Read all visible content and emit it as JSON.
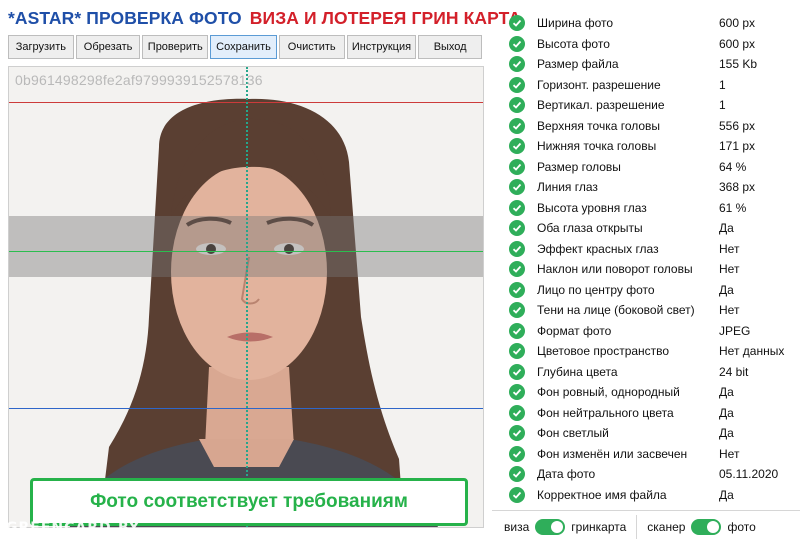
{
  "header": {
    "title_left": "*ASTAR* ПРОВЕРКА ФОТО",
    "title_right": "ВИЗА И ЛОТЕРЕЯ ГРИН КАРТА"
  },
  "toolbar": {
    "buttons": [
      "Загрузить",
      "Обрезать",
      "Проверить",
      "Сохранить",
      "Очистить",
      "Инструкция",
      "Выход"
    ],
    "active_index": 3
  },
  "photo": {
    "id_text": "0b961498298fe2af9799939152578136",
    "verdict": "Фото соответствует требованиям",
    "watermark": "GREENCARD.BY"
  },
  "checks": [
    {
      "label": "Ширина фото",
      "value": "600 px"
    },
    {
      "label": "Высота фото",
      "value": "600 px"
    },
    {
      "label": "Размер файла",
      "value": "155 Kb"
    },
    {
      "label": "Горизонт. разрешение",
      "value": "1"
    },
    {
      "label": "Вертикал. разрешение",
      "value": "1"
    },
    {
      "label": "Верхняя точка головы",
      "value": "556 px"
    },
    {
      "label": "Нижняя точка головы",
      "value": "171 px"
    },
    {
      "label": "Размер головы",
      "value": "64 %"
    },
    {
      "label": "Линия глаз",
      "value": "368 px"
    },
    {
      "label": "Высота уровня глаз",
      "value": "61 %"
    },
    {
      "label": "Оба глаза открыты",
      "value": "Да"
    },
    {
      "label": "Эффект красных глаз",
      "value": "Нет"
    },
    {
      "label": "Наклон или поворот головы",
      "value": "Нет"
    },
    {
      "label": "Лицо по центру фото",
      "value": "Да"
    },
    {
      "label": "Тени на лице (боковой свет)",
      "value": "Нет"
    },
    {
      "label": "Формат фото",
      "value": "JPEG"
    },
    {
      "label": "Цветовое пространство",
      "value": "Нет данных"
    },
    {
      "label": "Глубина цвета",
      "value": "24 bit"
    },
    {
      "label": "Фон ровный, однородный",
      "value": "Да"
    },
    {
      "label": "Фон нейтрального цвета",
      "value": "Да"
    },
    {
      "label": "Фон светлый",
      "value": "Да"
    },
    {
      "label": "Фон изменён или засвечен",
      "value": "Нет"
    },
    {
      "label": "Дата фото",
      "value": "05.11.2020"
    },
    {
      "label": "Корректное имя файла",
      "value": "Да"
    }
  ],
  "toggles": {
    "left": {
      "off_label": "виза",
      "on_label": "гринкарта"
    },
    "right": {
      "off_label": "сканер",
      "on_label": "фото"
    }
  },
  "colors": {
    "accent_green": "#2fae5a",
    "title_blue": "#1f4fa8",
    "title_red": "#d3202a"
  }
}
